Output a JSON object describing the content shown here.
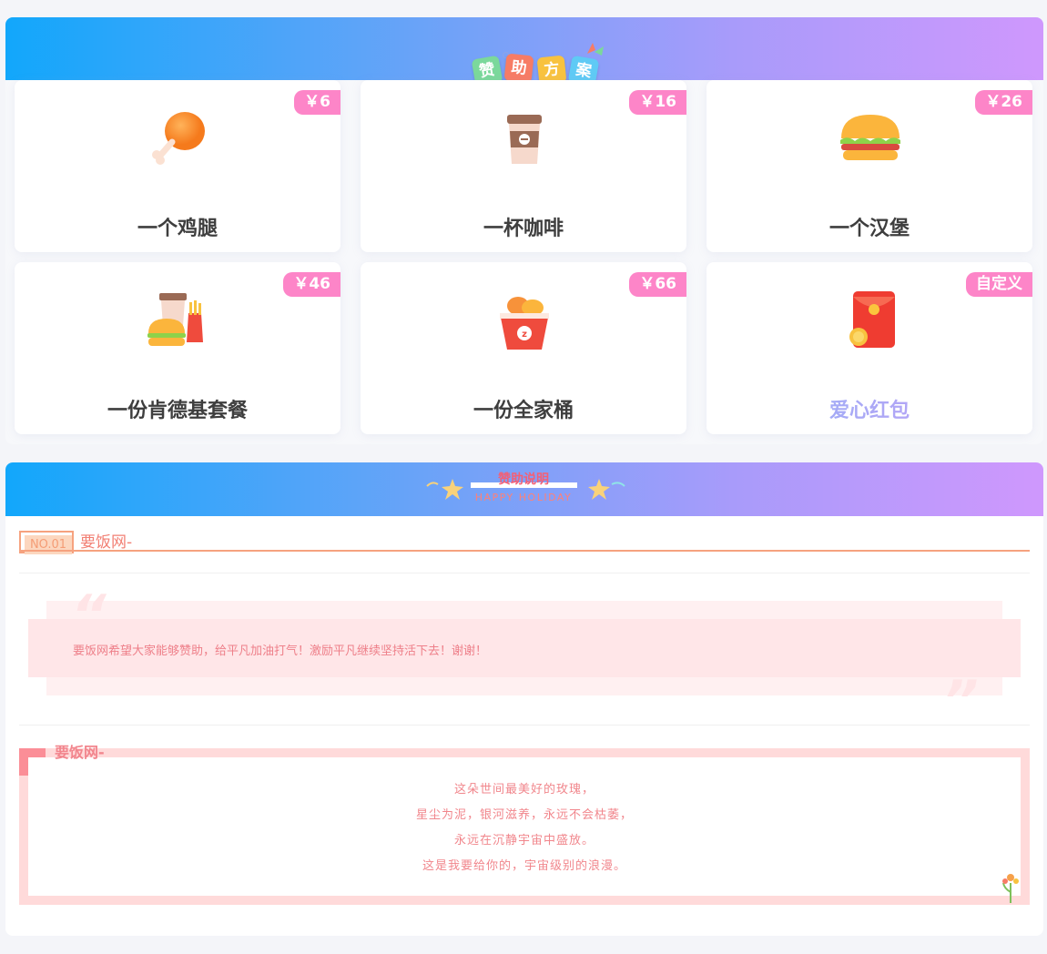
{
  "sponsor_section": {
    "badges": [
      "赞",
      "助",
      "方",
      "案"
    ],
    "plans": [
      {
        "price": "￥6",
        "name": "一个鸡腿",
        "icon": "chicken-leg-icon"
      },
      {
        "price": "￥16",
        "name": "一杯咖啡",
        "icon": "coffee-cup-icon"
      },
      {
        "price": "￥26",
        "name": "一个汉堡",
        "icon": "hamburger-icon"
      },
      {
        "price": "￥46",
        "name": "一份肯德基套餐",
        "icon": "fast-food-set-icon"
      },
      {
        "price": "￥66",
        "name": "一份全家桶",
        "icon": "chicken-bucket-icon"
      },
      {
        "price": "自定义",
        "name": "爱心红包",
        "icon": "red-envelope-icon"
      }
    ]
  },
  "explanation_section": {
    "title": "赞助说明",
    "subtitle": "HAPPY HOLIDAY",
    "block1": {
      "number": "NO.01",
      "title": "要饭网-",
      "quote": "要饭网希望大家能够赞助，给平凡加油打气！激励平凡继续坚持活下去！谢谢！"
    },
    "block2": {
      "title": "要饭网-",
      "lines": [
        "这朵世间最美好的玫瑰，",
        "星尘为泥，银河滋养，永远不会枯萎，",
        "永远在沉静宇宙中盛放。",
        "这是我要给你的，宇宙级别的浪漫。"
      ]
    }
  },
  "colors": {
    "header_start": "#12a7fb",
    "header_end": "#cf98fd",
    "price_tag": "#fd85c8",
    "accent_red": "#f36076"
  }
}
